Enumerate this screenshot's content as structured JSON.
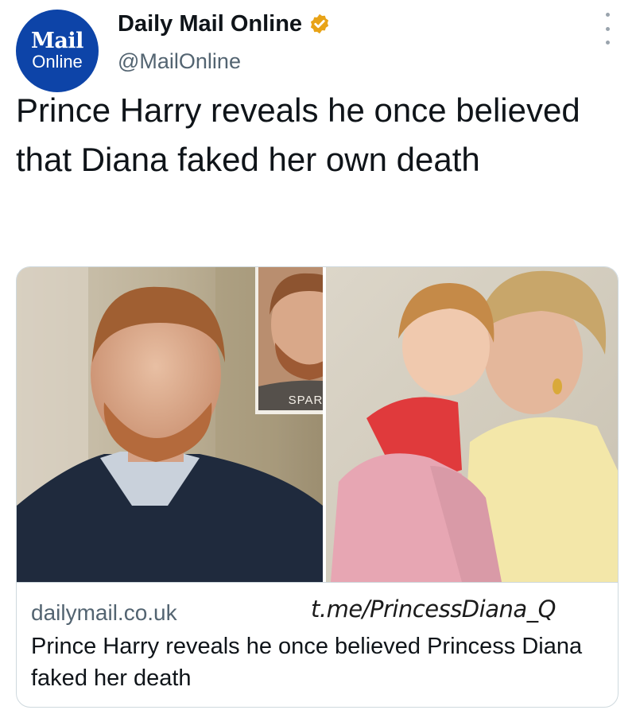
{
  "account": {
    "avatar": {
      "line1": "Mail",
      "line2": "Online"
    },
    "display_name": "Daily Mail Online",
    "handle": "@MailOnline",
    "verified_icon": "verified-badge-icon",
    "more_icon": "more-vertical-icon"
  },
  "tweet": {
    "text": "Prince Harry reveals he once believed that Diana faked her own death"
  },
  "card": {
    "image": {
      "description_icon": "article-photo-collage",
      "book_cover_label": "SPARE"
    },
    "domain": "dailymail.co.uk",
    "watermark": "t.me/PrincessDiana_Q",
    "title": "Prince Harry reveals he once believed Princess Diana faked her death"
  },
  "colors": {
    "avatar_bg": "#0d44a8",
    "verified": "#e8a317",
    "secondary_text": "#536471",
    "border": "#cfd9de"
  }
}
